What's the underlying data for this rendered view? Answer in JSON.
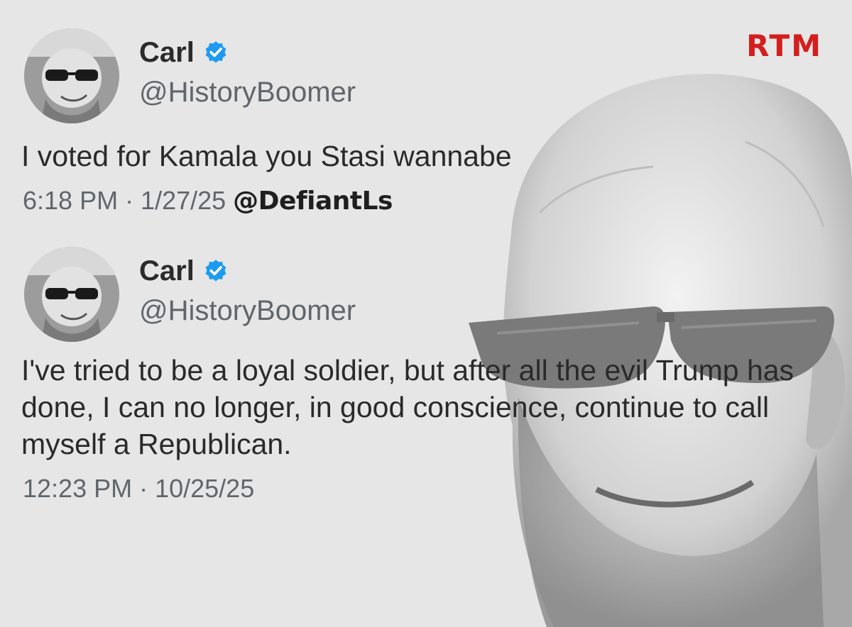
{
  "watermark": "RTM",
  "tweets": [
    {
      "display_name": "Carl",
      "handle": "@HistoryBoomer",
      "text": "I voted for Kamala you Stasi wannabe",
      "meta": "6:18 PM · 1/27/25",
      "credit": "@DefiantLs"
    },
    {
      "display_name": "Carl",
      "handle": "@HistoryBoomer",
      "text": "I've tried to be a loyal soldier, but after all the evil Trump has done, I can no longer, in good conscience, continue to call myself a Republican.",
      "meta": "12:23 PM · 10/25/25"
    }
  ],
  "icons": {
    "verified": "verified-badge-icon",
    "avatar": "avatar-photo"
  },
  "colors": {
    "watermark": "#d41e1e",
    "verified": "#1d9bf0",
    "background": "#e6e6e6"
  }
}
